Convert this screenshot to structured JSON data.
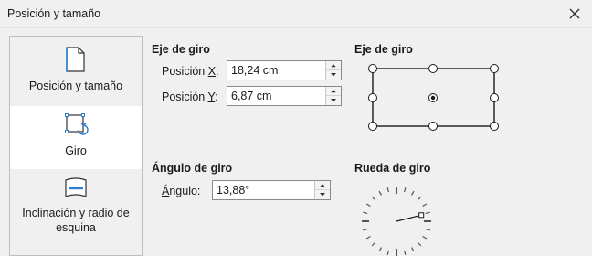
{
  "window": {
    "title": "Posición y tamaño"
  },
  "nav": {
    "items": [
      {
        "label": "Posición y tamaño",
        "icon": "position-size-icon"
      },
      {
        "label": "Giro",
        "icon": "rotation-icon"
      },
      {
        "label": "Inclinación y radio de esquina",
        "icon": "slant-icon"
      }
    ],
    "active_index": 1
  },
  "pivot": {
    "title": "Eje de giro",
    "x_label_prefix": "Posición ",
    "x_label_key": "X",
    "x_label_suffix": ":",
    "x_value": "18,24 cm",
    "y_label_prefix": "Posición ",
    "y_label_key": "Y",
    "y_label_suffix": ":",
    "y_value": "6,87 cm"
  },
  "pivot_picker": {
    "title": "Eje de giro",
    "selected": "center"
  },
  "angle": {
    "title": "Ángulo de giro",
    "label_key": "Á",
    "label_rest": "ngulo:",
    "value": "13,88°"
  },
  "wheel": {
    "title": "Rueda de giro",
    "angle_degrees": 13.88
  }
}
